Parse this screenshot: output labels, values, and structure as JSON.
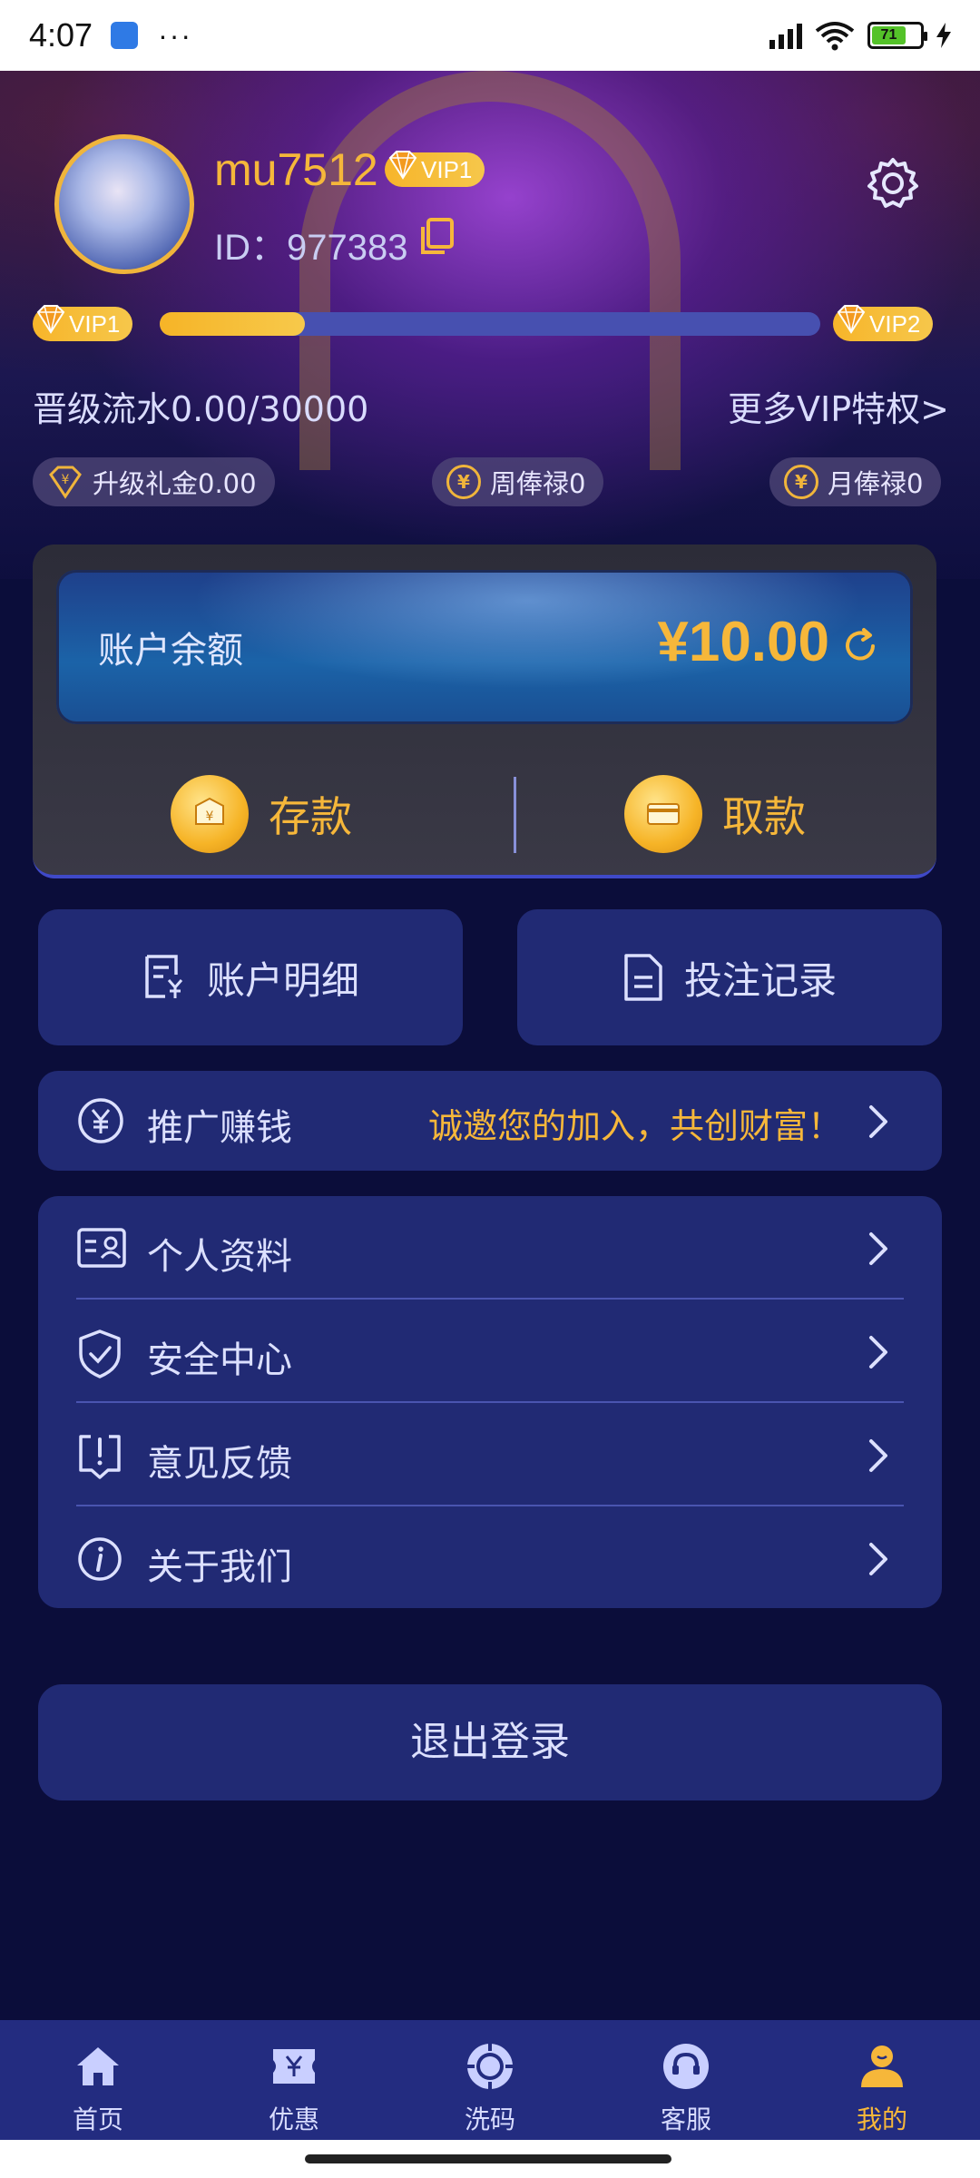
{
  "status_bar": {
    "time": "4:07",
    "more": "···",
    "battery": "71"
  },
  "profile": {
    "username": "mu7512",
    "vip_badge": "VIP1",
    "id_text": "ID：977383"
  },
  "vip_progress": {
    "current_level": "VIP1",
    "next_level": "VIP2",
    "progress_fraction": 0.22,
    "turnover_text": "晋级流水0.00/30000",
    "more_privileges": "更多VIP特权>"
  },
  "bonuses": [
    {
      "icon": "¥",
      "label": "升级礼金0.00"
    },
    {
      "icon": "¥",
      "label": "周俸禄0"
    },
    {
      "icon": "¥",
      "label": "月俸禄0"
    }
  ],
  "wallet": {
    "balance_label": "账户余额",
    "balance_value": "¥10.00",
    "deposit_label": "存款",
    "withdraw_label": "取款"
  },
  "tiles": {
    "account_detail": "账户明细",
    "bet_records": "投注记录"
  },
  "promo": {
    "label": "推广赚钱",
    "slogan": "诚邀您的加入，共创财富！"
  },
  "menu": [
    {
      "label": "个人资料",
      "icon": "id-card-icon"
    },
    {
      "label": "安全中心",
      "icon": "shield-check-icon"
    },
    {
      "label": "意见反馈",
      "icon": "feedback-icon"
    },
    {
      "label": "关于我们",
      "icon": "info-icon"
    }
  ],
  "logout_label": "退出登录",
  "bottom_nav": [
    {
      "label": "首页",
      "icon": "home-icon",
      "active": false
    },
    {
      "label": "优惠",
      "icon": "ticket-icon",
      "active": false
    },
    {
      "label": "洗码",
      "icon": "chip-icon",
      "active": false
    },
    {
      "label": "客服",
      "icon": "headset-icon",
      "active": false
    },
    {
      "label": "我的",
      "icon": "user-icon",
      "active": true
    }
  ],
  "colors": {
    "accent": "#f6b73a",
    "card": "#212a74",
    "background": "#0b0d3a"
  }
}
